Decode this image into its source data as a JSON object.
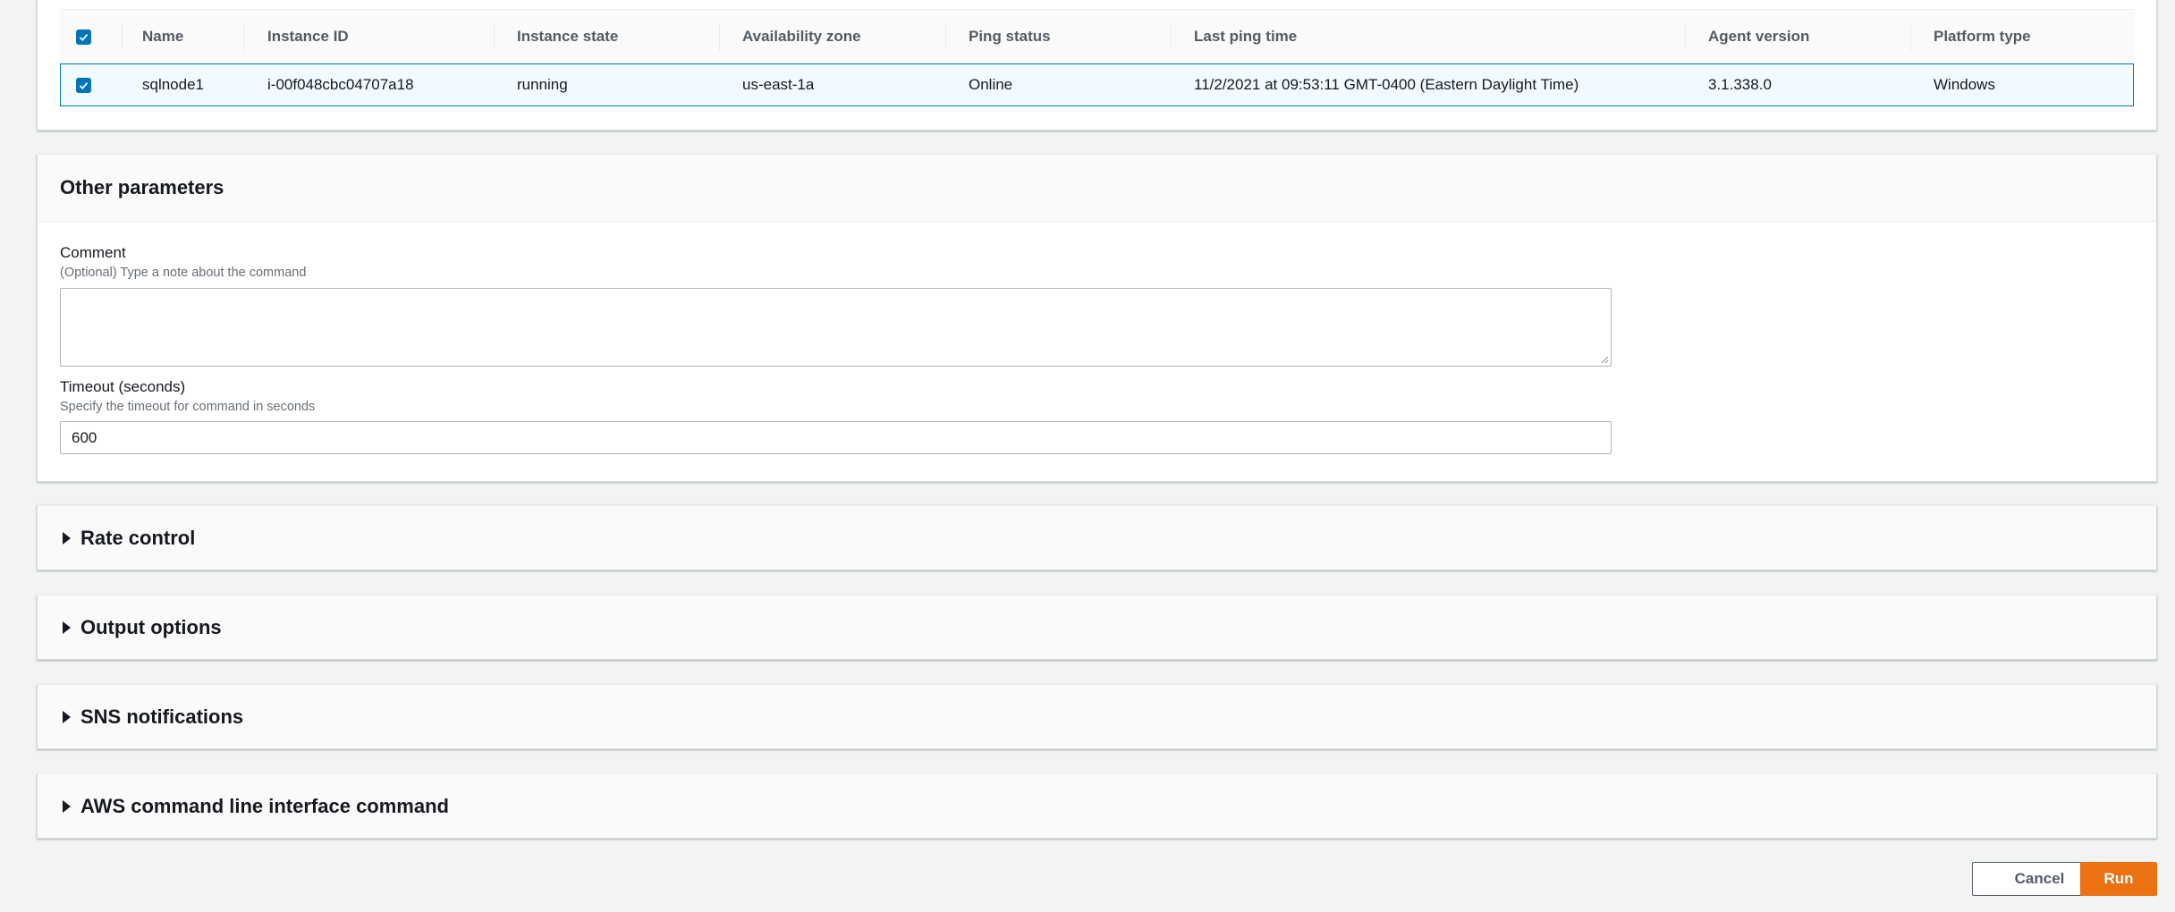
{
  "table": {
    "columns": [
      "Name",
      "Instance ID",
      "Instance state",
      "Availability zone",
      "Ping status",
      "Last ping time",
      "Agent version",
      "Platform type"
    ],
    "rows": [
      {
        "selected": true,
        "name": "sqlnode1",
        "instance_id": "i-00f048cbc04707a18",
        "state": "running",
        "zone": "us-east-1a",
        "ping": "Online",
        "last_ping": "11/2/2021 at 09:53:11 GMT-0400 (Eastern Daylight Time)",
        "agent_version": "3.1.338.0",
        "platform": "Windows"
      }
    ]
  },
  "params": {
    "title": "Other parameters",
    "comment_label": "Comment",
    "comment_desc": "(Optional) Type a note about the command",
    "comment_value": "",
    "timeout_label": "Timeout (seconds)",
    "timeout_desc": "Specify the timeout for command in seconds",
    "timeout_value": "600"
  },
  "sections": [
    "Rate control",
    "Output options",
    "SNS notifications",
    "AWS command line interface command"
  ],
  "buttons": {
    "cancel": "Cancel",
    "run": "Run"
  },
  "colors": {
    "primary_button": "#ec7211",
    "selected_border": "#0073bb",
    "checkbox": "#0073bb"
  }
}
